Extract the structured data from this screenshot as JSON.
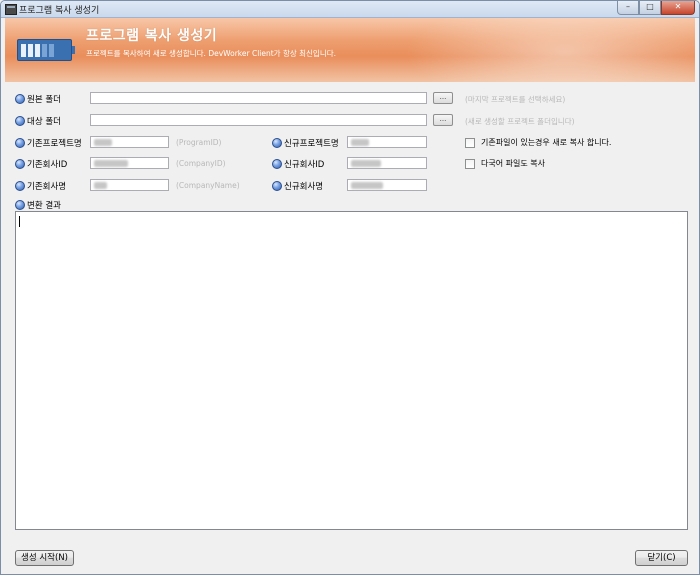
{
  "window": {
    "title": "프로그램 복사 생성기",
    "controls": {
      "minimize": "–",
      "maximize": "□",
      "close": "✕"
    }
  },
  "banner": {
    "title": "프로그램 복사 생성기",
    "subtitle": "프로젝트를 복사하여 새로 생성합니다. DevWorker Client가 항상 최신입니다."
  },
  "form": {
    "source_folder": {
      "label": "원본 폴더",
      "hint": "(마지막 프로젝트를 선택하세요)",
      "browse": "..."
    },
    "target_folder": {
      "label": "대상 폴더",
      "hint": "(새로 생성할 프로젝트 폴더입니다)",
      "browse": "..."
    },
    "existing_project": {
      "label": "기존프로젝트명",
      "hint": "(ProgramID)"
    },
    "existing_company_id": {
      "label": "기존회사ID",
      "hint": "(CompanyID)"
    },
    "existing_company_name": {
      "label": "기존회사명",
      "hint": "(CompanyName)"
    },
    "new_project": {
      "label": "신규프로젝트명"
    },
    "new_company_id": {
      "label": "신규회사ID"
    },
    "new_company_name": {
      "label": "신규회사명"
    },
    "overwrite_copy": {
      "label": "기존파일이 있는경우 새로 복사 합니다.",
      "checked": false
    },
    "multilang_copy": {
      "label": "다국어 파일도 복사",
      "checked": false
    },
    "result_label": "변환 결과"
  },
  "buttons": {
    "start": "생성 시작(N)",
    "close": "닫기(C)"
  }
}
